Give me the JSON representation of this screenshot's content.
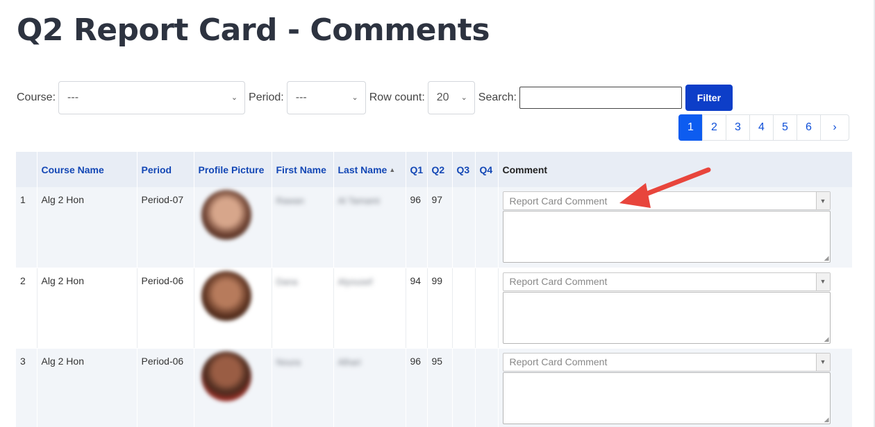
{
  "page": {
    "title": "Q2 Report Card - Comments"
  },
  "filters": {
    "course_label": "Course:",
    "course_value": "---",
    "period_label": "Period:",
    "period_value": "---",
    "rowcount_label": "Row count:",
    "rowcount_value": "20",
    "search_label": "Search:",
    "search_value": "",
    "filter_button": "Filter"
  },
  "pagination": {
    "pages": [
      "1",
      "2",
      "3",
      "4",
      "5",
      "6"
    ],
    "next": "›",
    "active": "1"
  },
  "table": {
    "columns": [
      "",
      "Course Name",
      "Period",
      "Profile Picture",
      "First Name",
      "Last Name",
      "Q1",
      "Q2",
      "Q3",
      "Q4",
      "Comment"
    ],
    "sort_indicator": "▲",
    "comment_placeholder": "Report Card Comment",
    "rows": [
      {
        "num": "1",
        "course": "Alg 2 Hon",
        "period": "Period-07",
        "first": "Rawan",
        "last": "Al Tamami",
        "q1": "96",
        "q2": "97",
        "q3": "",
        "q4": ""
      },
      {
        "num": "2",
        "course": "Alg 2 Hon",
        "period": "Period-06",
        "first": "Dana",
        "last": "Alyousef",
        "q1": "94",
        "q2": "99",
        "q3": "",
        "q4": ""
      },
      {
        "num": "3",
        "course": "Alg 2 Hon",
        "period": "Period-06",
        "first": "Noura",
        "last": "Alhari",
        "q1": "96",
        "q2": "95",
        "q3": "",
        "q4": ""
      }
    ]
  },
  "annotation": {
    "arrow_color": "#e8453c"
  }
}
